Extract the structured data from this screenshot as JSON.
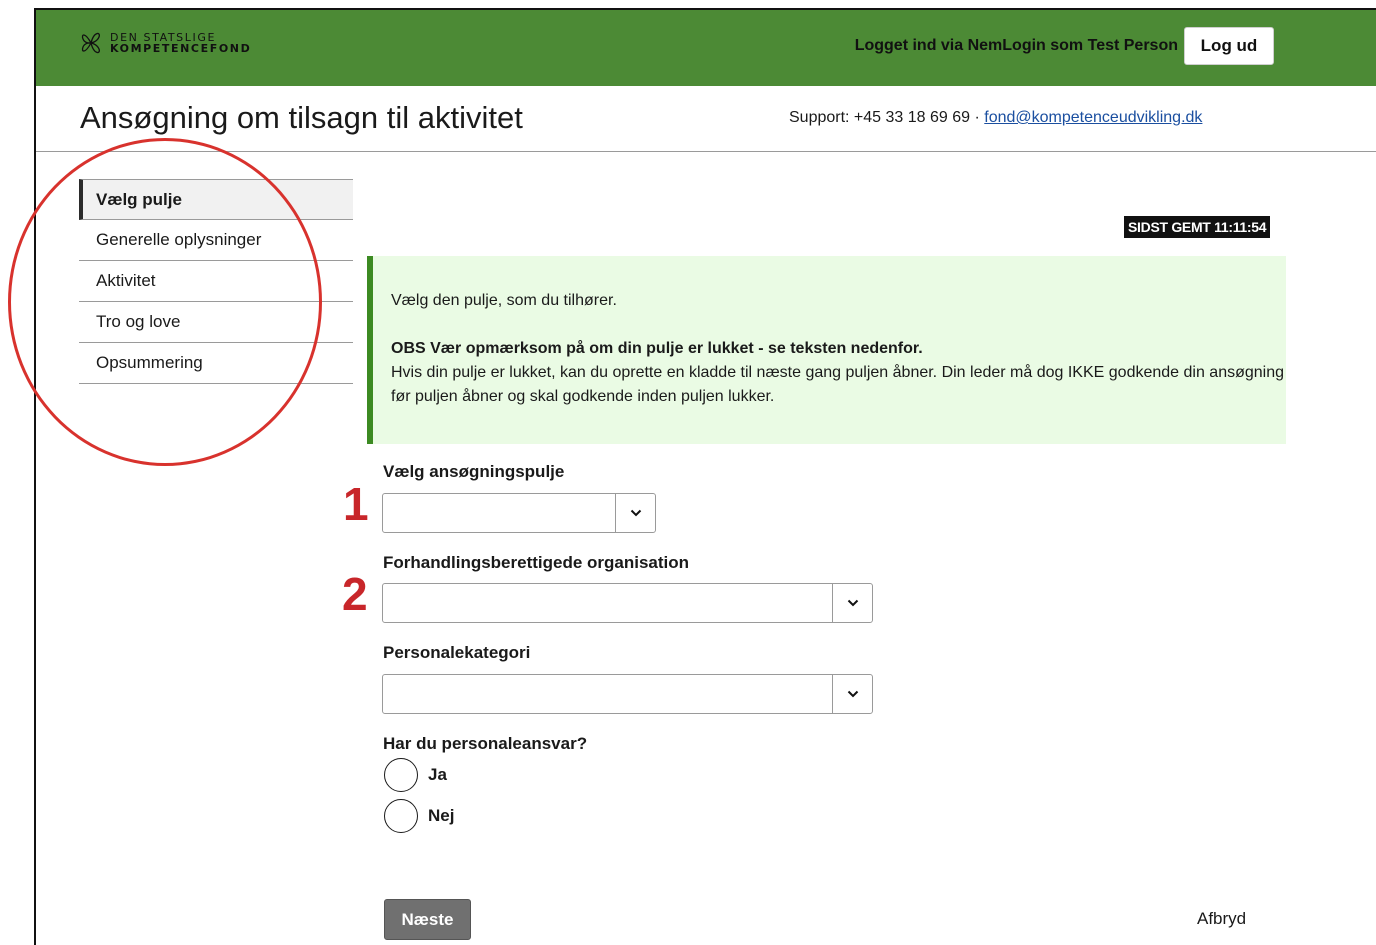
{
  "header": {
    "logo_line1": "DEN STATSLIGE",
    "logo_line2": "KOMPETENCEFOND",
    "login_status": "Logget ind via NemLogin som Test Person",
    "logout_label": "Log ud",
    "bar_color": "#4c8a35"
  },
  "title_bar": {
    "title": "Ansøgning om tilsagn til aktivitet",
    "support_prefix": "Support: +45 33 18 69 69 · ",
    "support_email": "fond@kompetenceudvikling.dk"
  },
  "sidebar": {
    "items": [
      {
        "label": "Vælg pulje",
        "active": true
      },
      {
        "label": "Generelle oplysninger",
        "active": false
      },
      {
        "label": "Aktivitet",
        "active": false
      },
      {
        "label": "Tro og love",
        "active": false
      },
      {
        "label": "Opsummering",
        "active": false
      }
    ]
  },
  "saved_badge": "SIDST GEMT 11:11:54",
  "info_box": {
    "line1": "Vælg den pulje, som du tilhører.",
    "notice_bold": "OBS Vær opmærksom på om din pulje er lukket - se teksten nedenfor.",
    "notice_text": "Hvis din pulje er lukket, kan du oprette en kladde til næste gang puljen åbner. Din leder må dog IKKE godkende din ansøgning før puljen åbner og skal godkende inden puljen lukker."
  },
  "form": {
    "pool_label": "Vælg ansøgningspulje",
    "pool_value": "",
    "org_label": "Forhandlingsberettigede organisation",
    "org_value": "",
    "category_label": "Personalekategori",
    "category_value": "",
    "responsibility_question": "Har du personaleansvar?",
    "options": [
      "Ja",
      "Nej"
    ]
  },
  "annotations": {
    "num1": "1",
    "num2": "2",
    "color": "#d8322d"
  },
  "actions": {
    "next_label": "Næste",
    "cancel_label": "Afbryd"
  }
}
